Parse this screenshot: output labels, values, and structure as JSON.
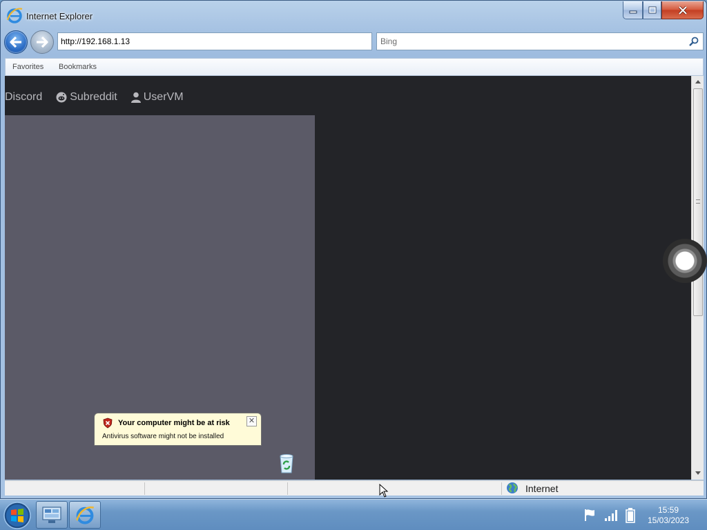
{
  "window": {
    "title": "Internet Explorer",
    "controls": {
      "minimize": "minimize",
      "maximize": "maximize",
      "close": "close"
    }
  },
  "toolbar": {
    "address": "http://192.168.1.13",
    "search_placeholder": "Bing"
  },
  "favorites_bar": {
    "items": [
      {
        "label": "Favorites"
      },
      {
        "label": "Bookmarks"
      }
    ]
  },
  "page": {
    "nav_links": [
      {
        "label": "Discord",
        "icon": "none"
      },
      {
        "label": "Subreddit",
        "icon": "reddit-icon"
      },
      {
        "label": "UserVM",
        "icon": "user-icon"
      }
    ],
    "popup": {
      "title": "Your computer might be at risk",
      "subtitle": "Antivirus software might not be installed"
    }
  },
  "status_bar": {
    "zone": "Internet"
  },
  "taskbar": {
    "time": "15:59",
    "date": "15/03/2023"
  },
  "colors": {
    "page_background": "#232428",
    "vm_screen": "#5b5a67",
    "nav_link": "#b8b8bd"
  }
}
